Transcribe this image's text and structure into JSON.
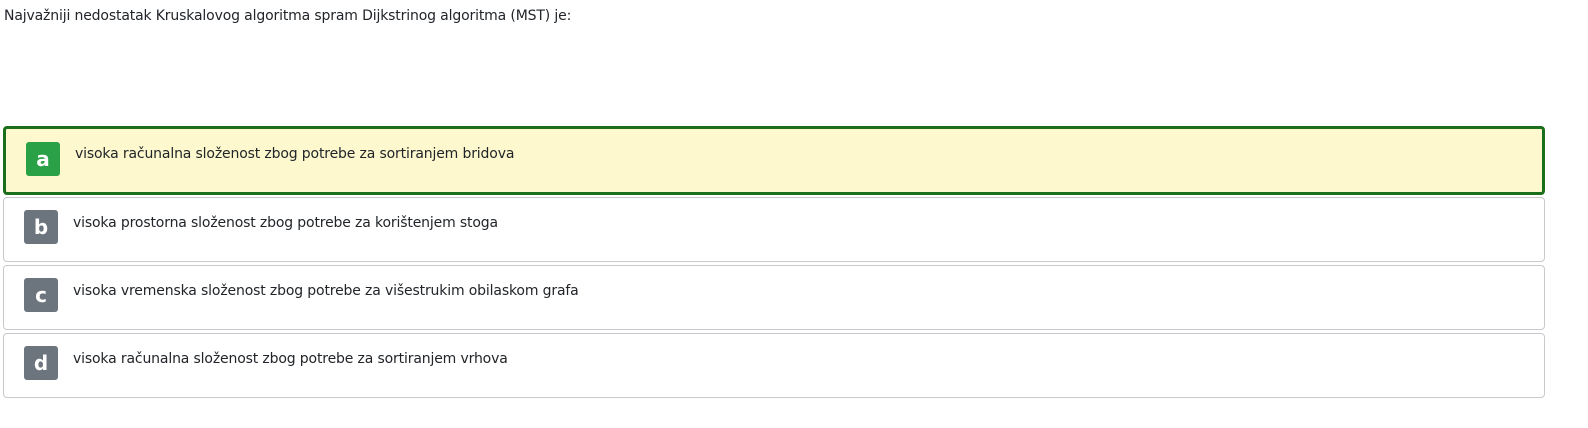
{
  "question": {
    "text": "Najvažniji nedostatak Kruskalovog algoritma spram Dijkstrinog algoritma (MST) je:"
  },
  "answers": [
    {
      "letter": "a",
      "text": "visoka računalna složenost zbog potrebe za sortiranjem bridova",
      "selected": true
    },
    {
      "letter": "b",
      "text": "visoka prostorna složenost zbog potrebe za korištenjem stoga",
      "selected": false
    },
    {
      "letter": "c",
      "text": "visoka vremenska složenost zbog potrebe za višestrukim obilaskom grafa",
      "selected": false
    },
    {
      "letter": "d",
      "text": "visoka računalna složenost zbog potrebe za sortiranjem vrhova",
      "selected": false
    }
  ],
  "colors": {
    "selected_border": "#1b6e1b",
    "selected_background": "#fdf8cd",
    "selected_badge": "#2aa146",
    "default_badge": "#6c757d",
    "default_border": "#c7c9cc"
  }
}
